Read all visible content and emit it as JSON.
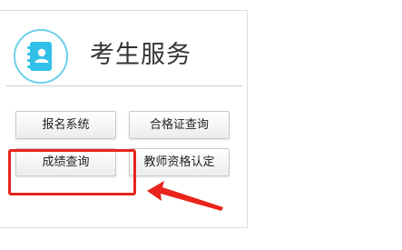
{
  "service": {
    "title": "考生服务",
    "icon": "contact-book-icon"
  },
  "buttons": {
    "registration": "报名系统",
    "certificate_query": "合格证查询",
    "score_query": "成绩查询",
    "teacher_qualification": "教师资格认定"
  },
  "colors": {
    "accent": "#31c0e8",
    "annotation": "#e8241c"
  }
}
